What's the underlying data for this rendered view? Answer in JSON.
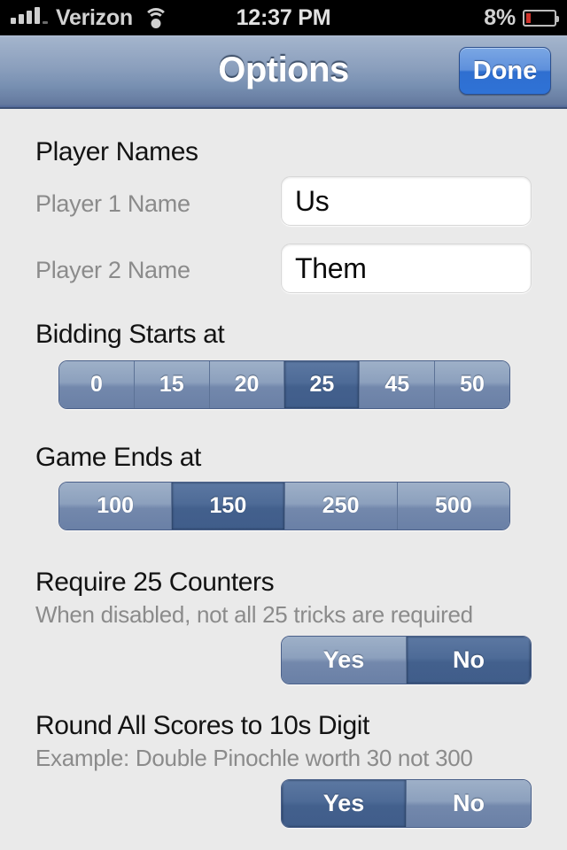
{
  "status_bar": {
    "signal_icon": "signal-bars-icon",
    "carrier": "Verizon",
    "wifi_icon": "wifi-icon",
    "time": "12:37 PM",
    "battery_percent": "8%",
    "battery_icon": "battery-icon"
  },
  "nav_bar": {
    "title": "Options",
    "done_label": "Done"
  },
  "sections": {
    "player_names": {
      "title": "Player Names",
      "player1": {
        "label": "Player 1 Name",
        "value": "Us",
        "placeholder": "Player 1 Name"
      },
      "player2": {
        "label": "Player 2 Name",
        "value": "Them",
        "placeholder": "Player 2 Name"
      }
    },
    "bidding_starts": {
      "title": "Bidding Starts at",
      "options": [
        "0",
        "15",
        "20",
        "25",
        "45",
        "50"
      ],
      "selected": "25"
    },
    "game_ends": {
      "title": "Game Ends at",
      "options": [
        "100",
        "150",
        "250",
        "500"
      ],
      "selected": "150"
    },
    "require_counters": {
      "title": "Require 25 Counters",
      "subtitle": "When disabled, not all 25 tricks are required",
      "options": [
        "Yes",
        "No"
      ],
      "selected": "No"
    },
    "round_scores": {
      "title": "Round All Scores to 10s Digit",
      "subtitle": "Example: Double Pinochle worth 30 not 300",
      "options": [
        "Yes",
        "No"
      ],
      "selected": "Yes"
    }
  },
  "colors": {
    "accent_blue": "#2f6fd0",
    "nav_top": "#b3c1d6",
    "nav_bottom": "#51689a",
    "segment_selected": "#43608d",
    "segment_normal": "#8ca0bd",
    "background": "#eaeaea",
    "battery_low": "#d0342c"
  }
}
